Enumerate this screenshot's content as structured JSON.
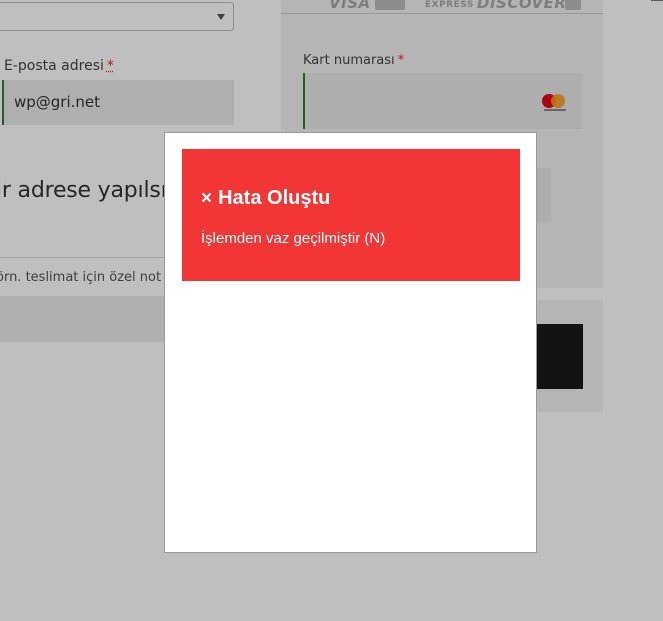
{
  "checkout": {
    "email_label": "E-posta adresi",
    "required_mark": "*",
    "email_value": "wp@gri.net",
    "address_heading": "ir adrese yapılsın",
    "notes_placeholder": "örn. teslimat için özel not"
  },
  "payment": {
    "brands": [
      "VISA",
      "EXPRESS",
      "DISCOVER"
    ],
    "card_number_label": "Kart numarası",
    "required_mark": "*"
  },
  "modal": {
    "error_icon": "×",
    "error_title": "Hata Oluştu",
    "error_message": "İşlemden vaz geçilmiştir (N)"
  },
  "colors": {
    "error_red": "#f23535",
    "field_focus_green": "#2e7d32",
    "overlay": "rgba(0,0,0,0.25)"
  }
}
